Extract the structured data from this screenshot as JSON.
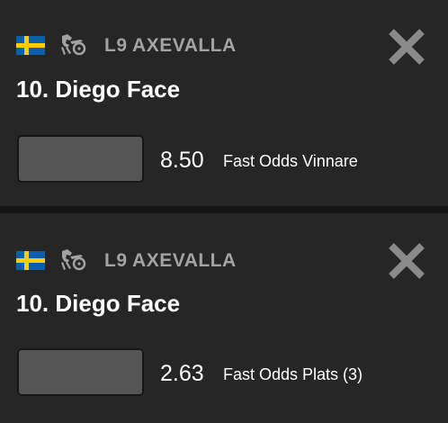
{
  "colors": {
    "card_background": "#262626",
    "page_background": "#141414",
    "label_gray": "#a3a3a3",
    "input_fill": "#555555",
    "flag_blue": "#0a5fa8",
    "flag_yellow": "#fecc00"
  },
  "bets": [
    {
      "flag_icon": "sweden-flag-icon",
      "sport_icon": "harness-trotting-icon",
      "race": "L9 AXEVALLA",
      "horse": "10. Diego Face",
      "stake_value": "",
      "odds": "8.50",
      "bet_type": "Fast Odds Vinnare",
      "close_icon": "close-icon"
    },
    {
      "flag_icon": "sweden-flag-icon",
      "sport_icon": "harness-trotting-icon",
      "race": "L9 AXEVALLA",
      "horse": "10. Diego Face",
      "stake_value": "",
      "odds": "2.63",
      "bet_type": "Fast Odds Plats (3)",
      "close_icon": "close-icon"
    }
  ]
}
